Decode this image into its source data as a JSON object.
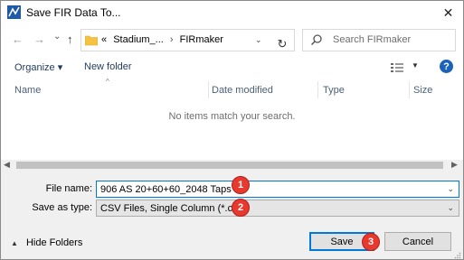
{
  "window": {
    "title": "Save FIR Data To...",
    "close_glyph": "✕"
  },
  "nav": {
    "back_glyph": "←",
    "forward_glyph": "→",
    "history_glyph": "⌄",
    "up_glyph": "↑",
    "path_prefix": "«",
    "path_parent": "Stadium_...",
    "path_sep": "›",
    "path_current": "FIRmaker",
    "dropdown_glyph": "⌄",
    "refresh_glyph": "↻",
    "search_placeholder": "Search FIRmaker"
  },
  "toolbar": {
    "organize": "Organize ▾",
    "new_folder": "New folder",
    "help": "?"
  },
  "list": {
    "columns": [
      "Name",
      "Date modified",
      "Type",
      "Size"
    ],
    "empty_message": "No items match your search."
  },
  "form": {
    "file_name_label": "File name:",
    "file_name_value": "906 AS 20+60+60_2048 Taps",
    "save_type_label": "Save as type:",
    "save_type_value": "CSV Files, Single Column (*.csv)"
  },
  "footer": {
    "hide_folders": "Hide Folders",
    "save": "Save",
    "cancel": "Cancel"
  },
  "badges": [
    "1",
    "2",
    "3"
  ],
  "icons": {
    "app": "app-icon",
    "folder": "folder-icon",
    "search": "search-icon",
    "views": "view-options-icon"
  },
  "colors": {
    "accent": "#0078d7",
    "badge": "#e8392f",
    "help": "#1c62b9",
    "folder": "#f5c342"
  }
}
